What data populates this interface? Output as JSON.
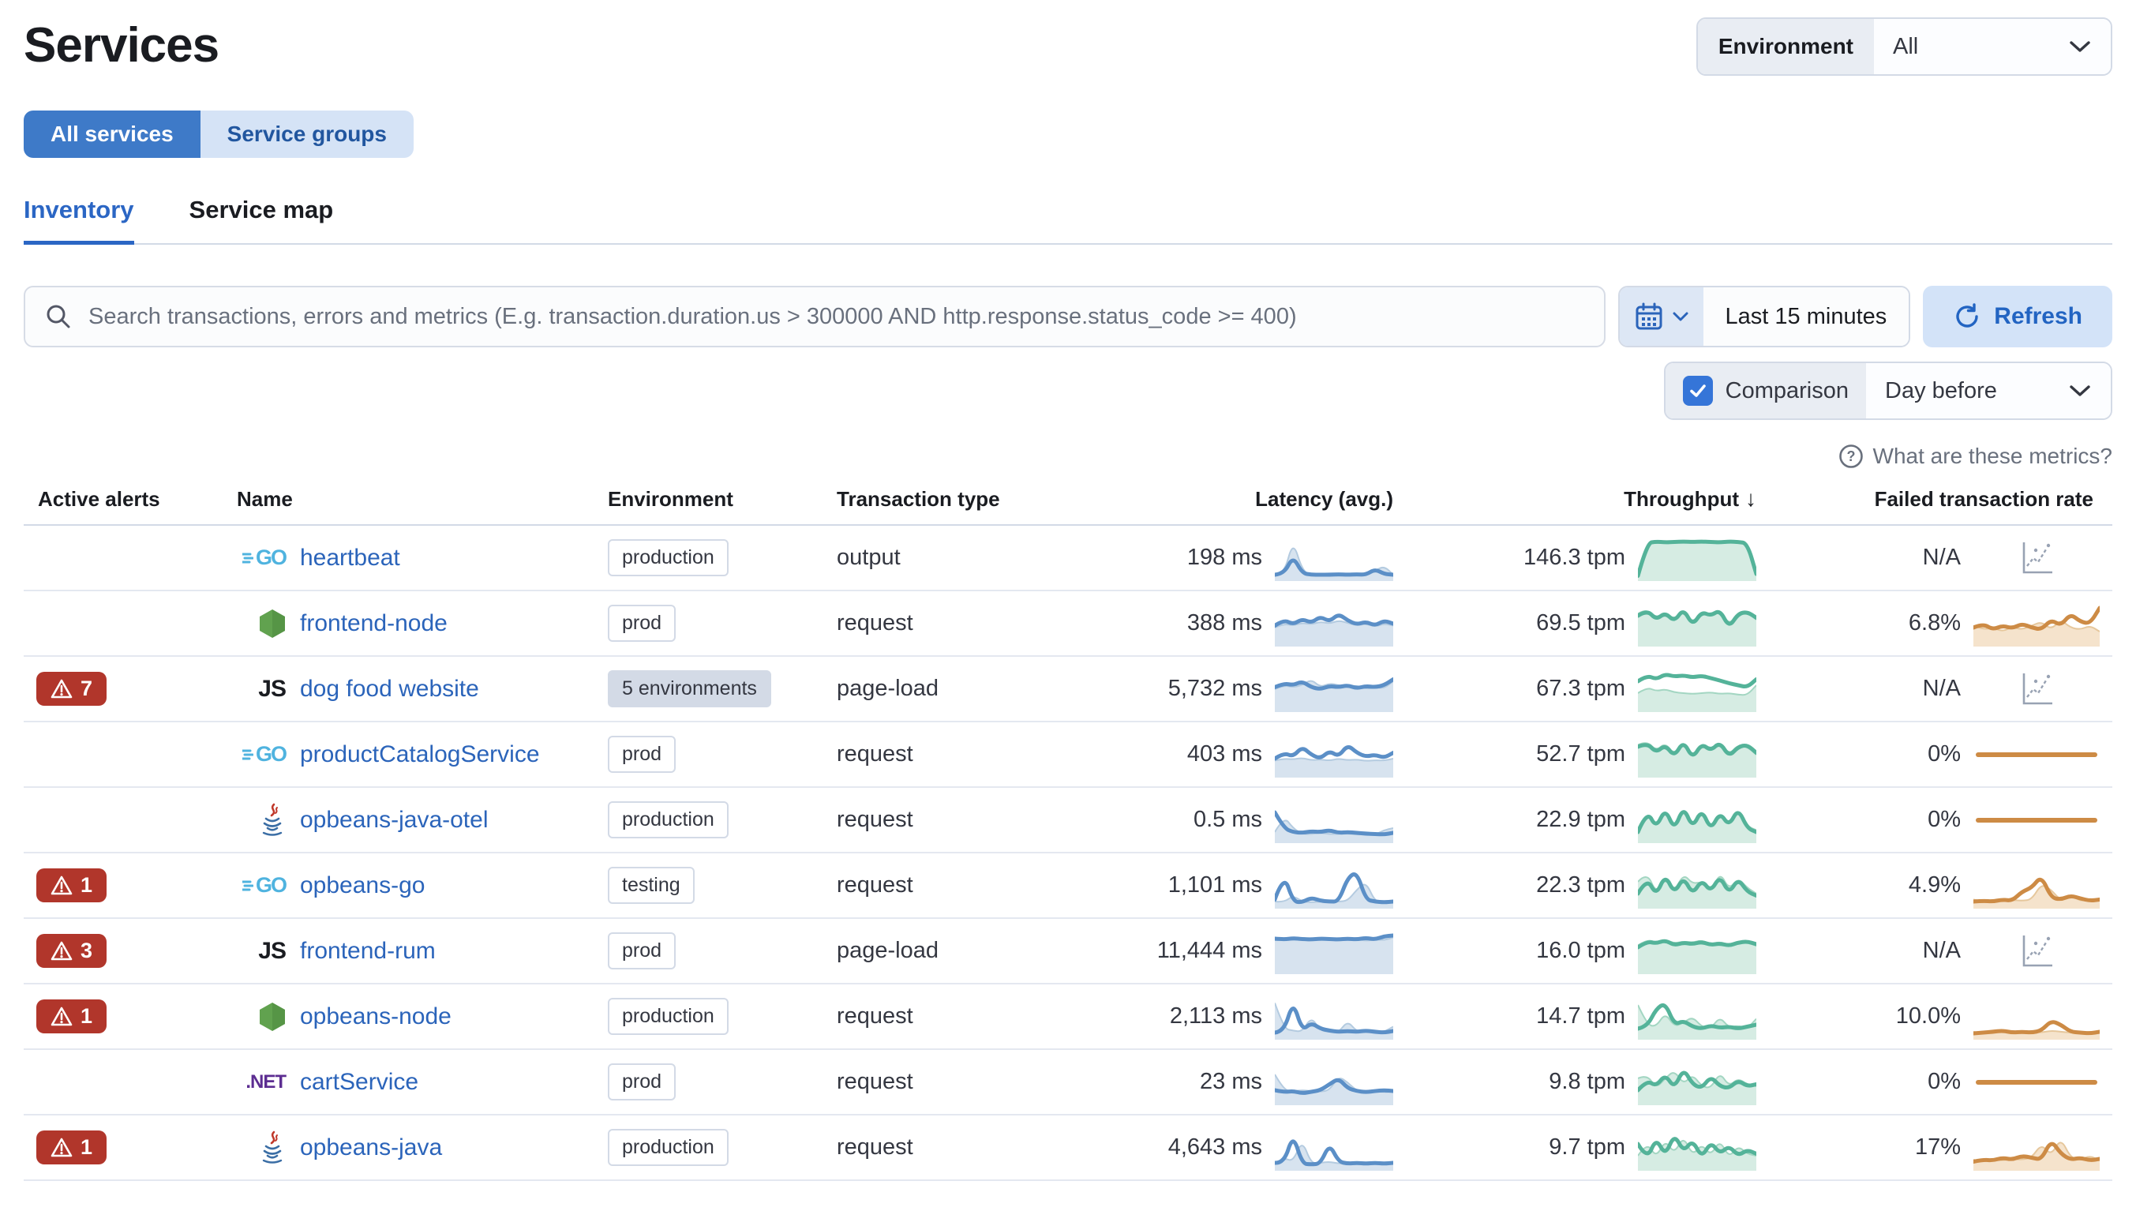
{
  "page": {
    "title": "Services"
  },
  "env_filter": {
    "label": "Environment",
    "value": "All"
  },
  "view_toggle": {
    "all_label": "All services",
    "groups_label": "Service groups"
  },
  "tabs": {
    "inventory": "Inventory",
    "service_map": "Service map"
  },
  "search": {
    "placeholder": "Search transactions, errors and metrics (E.g. transaction.duration.us > 300000 AND http.response.status_code >= 400)"
  },
  "time_picker": {
    "range": "Last 15 minutes",
    "refresh_label": "Refresh"
  },
  "comparison": {
    "label": "Comparison",
    "checked": true,
    "value": "Day before"
  },
  "help": {
    "label": "What are these metrics?"
  },
  "colors": {
    "primary_blue": "#2b64ba",
    "danger_red": "#b1362b",
    "latency_blue": "#5b8fc7",
    "throughput_green": "#54b399",
    "failed_orange": "#cd8b45"
  },
  "table": {
    "columns": [
      "Active alerts",
      "Name",
      "Environment",
      "Transaction type",
      "Latency (avg.)",
      "Throughput",
      "Failed transaction rate"
    ],
    "sort": {
      "column": "Throughput",
      "direction": "desc"
    },
    "rows": [
      {
        "alerts": null,
        "icon": "go",
        "name": "heartbeat",
        "env": "production",
        "env_style": "outline",
        "tx": "output",
        "latency": "198 ms",
        "throughput": "146.3 tpm",
        "failed": "N/A",
        "failed_type": "na",
        "lat_line": [
          8,
          10,
          55,
          12,
          8,
          8,
          8,
          9,
          8,
          9,
          8,
          22,
          10,
          8
        ],
        "lat_comp": [
          5,
          8,
          95,
          20,
          6,
          5,
          5,
          6,
          5,
          6,
          5,
          18,
          30,
          8
        ],
        "thr_line": [
          5,
          88,
          92,
          90,
          91,
          92,
          91,
          92,
          91,
          90,
          92,
          91,
          88,
          10
        ],
        "thr_comp": [
          8,
          85,
          90,
          88,
          90,
          91,
          90,
          91,
          90,
          89,
          91,
          90,
          86,
          12
        ],
        "fail_line": [],
        "fail_comp": []
      },
      {
        "alerts": null,
        "icon": "node",
        "name": "frontend-node",
        "env": "prod",
        "env_style": "outline",
        "tx": "request",
        "latency": "388 ms",
        "throughput": "69.5 tpm",
        "failed": "6.8%",
        "failed_type": "spark",
        "lat_line": [
          45,
          60,
          48,
          62,
          52,
          68,
          55,
          75,
          58,
          48,
          55,
          45,
          58,
          50
        ],
        "lat_comp": [
          40,
          50,
          45,
          52,
          48,
          55,
          50,
          58,
          52,
          45,
          50,
          42,
          50,
          45
        ],
        "thr_line": [
          70,
          85,
          60,
          78,
          55,
          88,
          45,
          80,
          70,
          85,
          40,
          75,
          80,
          65
        ],
        "thr_comp": [
          75,
          90,
          55,
          80,
          60,
          85,
          50,
          85,
          65,
          90,
          45,
          80,
          80,
          60
        ],
        "fail_line": [
          40,
          50,
          35,
          45,
          38,
          50,
          40,
          35,
          60,
          45,
          75,
          55,
          50,
          90
        ],
        "fail_comp": [
          45,
          35,
          40,
          30,
          42,
          35,
          45,
          55,
          35,
          60,
          40,
          35,
          45,
          30
        ]
      },
      {
        "alerts": 7,
        "icon": "js",
        "name": "dog food website",
        "env": "5 environments",
        "env_style": "filled",
        "tx": "page-load",
        "latency": "5,732 ms",
        "throughput": "67.3 tpm",
        "failed": "N/A",
        "failed_type": "na",
        "lat_line": [
          55,
          65,
          60,
          70,
          55,
          50,
          58,
          55,
          60,
          52,
          58,
          55,
          60,
          75
        ],
        "lat_comp": [
          50,
          60,
          55,
          60,
          75,
          55,
          65,
          60,
          55,
          60,
          50,
          55,
          52,
          70
        ],
        "thr_line": [
          70,
          85,
          75,
          88,
          82,
          85,
          80,
          84,
          78,
          72,
          65,
          60,
          55,
          75
        ],
        "thr_comp": [
          40,
          55,
          45,
          50,
          42,
          40,
          38,
          40,
          42,
          38,
          40,
          36,
          35,
          60
        ],
        "fail_line": [],
        "fail_comp": []
      },
      {
        "alerts": null,
        "icon": "go",
        "name": "productCatalogService",
        "env": "prod",
        "env_style": "outline",
        "tx": "request",
        "latency": "403 ms",
        "throughput": "52.7 tpm",
        "failed": "0%",
        "failed_type": "flat",
        "lat_line": [
          40,
          55,
          45,
          70,
          50,
          40,
          60,
          45,
          75,
          55,
          45,
          50,
          42,
          55
        ],
        "lat_comp": [
          35,
          40,
          38,
          42,
          36,
          38,
          35,
          40,
          36,
          38,
          34,
          36,
          35,
          40
        ],
        "thr_line": [
          70,
          80,
          55,
          75,
          45,
          85,
          40,
          78,
          60,
          82,
          45,
          70,
          75,
          55
        ],
        "thr_comp": [
          75,
          85,
          60,
          80,
          50,
          80,
          45,
          82,
          55,
          85,
          50,
          75,
          70,
          50
        ],
        "fail_line": [],
        "fail_comp": []
      },
      {
        "alerts": null,
        "icon": "java",
        "name": "opbeans-java-otel",
        "env": "production",
        "env_style": "outline",
        "tx": "request",
        "latency": "0.5 ms",
        "throughput": "22.9 tpm",
        "failed": "0%",
        "failed_type": "flat",
        "lat_line": [
          70,
          30,
          20,
          18,
          22,
          20,
          25,
          18,
          20,
          18,
          16,
          15,
          14,
          18
        ],
        "lat_comp": [
          20,
          60,
          30,
          15,
          15,
          18,
          15,
          15,
          16,
          14,
          15,
          13,
          25,
          30
        ],
        "thr_line": [
          20,
          75,
          30,
          80,
          25,
          85,
          30,
          78,
          25,
          70,
          35,
          80,
          30,
          20
        ],
        "thr_comp": [
          25,
          70,
          35,
          75,
          30,
          80,
          35,
          72,
          30,
          65,
          40,
          75,
          35,
          25
        ],
        "fail_line": [],
        "fail_comp": []
      },
      {
        "alerts": 1,
        "icon": "go",
        "name": "opbeans-go",
        "env": "testing",
        "env_style": "outline",
        "tx": "request",
        "latency": "1,101 ms",
        "throughput": "22.3 tpm",
        "failed": "4.9%",
        "failed_type": "spark",
        "lat_line": [
          15,
          80,
          10,
          8,
          20,
          12,
          10,
          10,
          70,
          85,
          15,
          10,
          8,
          10
        ],
        "lat_comp": [
          10,
          8,
          25,
          10,
          8,
          10,
          8,
          10,
          12,
          40,
          60,
          10,
          8,
          8
        ],
        "thr_line": [
          30,
          70,
          25,
          78,
          30,
          72,
          28,
          65,
          35,
          75,
          30,
          68,
          35,
          25
        ],
        "thr_comp": [
          60,
          85,
          30,
          70,
          35,
          80,
          55,
          60,
          30,
          85,
          40,
          70,
          45,
          30
        ],
        "fail_line": [
          10,
          12,
          10,
          15,
          12,
          35,
          45,
          75,
          20,
          15,
          25,
          18,
          12,
          15
        ],
        "fail_comp": [
          15,
          10,
          12,
          10,
          14,
          12,
          15,
          55,
          40,
          12,
          30,
          10,
          18,
          12
        ]
      },
      {
        "alerts": 3,
        "icon": "js",
        "name": "frontend-rum",
        "env": "prod",
        "env_style": "outline",
        "tx": "page-load",
        "latency": "11,444 ms",
        "throughput": "16.0 tpm",
        "failed": "N/A",
        "failed_type": "na",
        "lat_line": [
          82,
          80,
          83,
          81,
          80,
          82,
          81,
          80,
          82,
          80,
          84,
          80,
          88,
          90
        ],
        "lat_comp": [
          78,
          80,
          79,
          81,
          78,
          80,
          79,
          80,
          78,
          82,
          76,
          80,
          78,
          85
        ],
        "thr_line": [
          60,
          75,
          70,
          78,
          65,
          72,
          68,
          74,
          66,
          70,
          64,
          72,
          75,
          68
        ],
        "thr_comp": [
          65,
          80,
          72,
          80,
          70,
          75,
          72,
          78,
          68,
          74,
          66,
          76,
          72,
          64
        ],
        "fail_line": [],
        "fail_comp": []
      },
      {
        "alerts": 1,
        "icon": "node",
        "name": "opbeans-node",
        "env": "production",
        "env_style": "outline",
        "tx": "request",
        "latency": "2,113 ms",
        "throughput": "14.7 tpm",
        "failed": "10.0%",
        "failed_type": "spark",
        "lat_line": [
          10,
          12,
          90,
          15,
          35,
          20,
          15,
          12,
          14,
          12,
          15,
          12,
          10,
          14
        ],
        "lat_comp": [
          85,
          20,
          15,
          12,
          50,
          15,
          12,
          10,
          40,
          12,
          15,
          10,
          12,
          25
        ],
        "thr_line": [
          20,
          25,
          70,
          85,
          30,
          40,
          25,
          20,
          28,
          22,
          25,
          20,
          25,
          30
        ],
        "thr_comp": [
          80,
          30,
          25,
          60,
          25,
          35,
          50,
          25,
          20,
          50,
          22,
          28,
          20,
          45
        ],
        "fail_line": [
          8,
          10,
          12,
          15,
          10,
          12,
          10,
          15,
          40,
          30,
          12,
          10,
          8,
          12
        ],
        "fail_comp": [
          12,
          8,
          10,
          12,
          15,
          10,
          12,
          10,
          15,
          12,
          10,
          8,
          12,
          10
        ]
      },
      {
        "alerts": null,
        "icon": "dotnet",
        "name": "cartService",
        "env": "prod",
        "env_style": "outline",
        "tx": "request",
        "latency": "23 ms",
        "throughput": "9.8 tpm",
        "failed": "0%",
        "failed_type": "flat",
        "lat_line": [
          30,
          25,
          28,
          22,
          26,
          30,
          45,
          60,
          35,
          28,
          25,
          28,
          30,
          28
        ],
        "lat_comp": [
          70,
          30,
          28,
          30,
          28,
          26,
          30,
          65,
          50,
          28,
          26,
          28,
          25,
          26
        ],
        "thr_line": [
          30,
          55,
          40,
          70,
          35,
          85,
          45,
          35,
          65,
          40,
          35,
          55,
          40,
          45
        ],
        "thr_comp": [
          60,
          70,
          35,
          60,
          80,
          45,
          70,
          40,
          35,
          75,
          40,
          60,
          45,
          40
        ],
        "fail_line": [],
        "fail_comp": []
      },
      {
        "alerts": 1,
        "icon": "java",
        "name": "opbeans-java",
        "env": "production",
        "env_style": "outline",
        "tx": "request",
        "latency": "4,643 ms",
        "throughput": "9.7 tpm",
        "failed": "17%",
        "failed_type": "spark",
        "lat_line": [
          12,
          10,
          85,
          10,
          8,
          10,
          60,
          15,
          10,
          12,
          10,
          12,
          10,
          12
        ],
        "lat_comp": [
          10,
          25,
          15,
          70,
          10,
          12,
          15,
          10,
          12,
          10,
          14,
          10,
          12,
          10
        ],
        "thr_line": [
          60,
          20,
          75,
          30,
          85,
          40,
          70,
          25,
          65,
          35,
          55,
          30,
          45,
          35
        ],
        "thr_comp": [
          30,
          65,
          25,
          70,
          35,
          80,
          30,
          60,
          30,
          70,
          25,
          55,
          35,
          30
        ],
        "fail_line": [
          15,
          20,
          18,
          25,
          20,
          30,
          25,
          20,
          70,
          35,
          20,
          25,
          18,
          22
        ],
        "fail_comp": [
          20,
          15,
          20,
          18,
          22,
          20,
          25,
          60,
          30,
          75,
          25,
          20,
          30,
          18
        ]
      }
    ]
  }
}
